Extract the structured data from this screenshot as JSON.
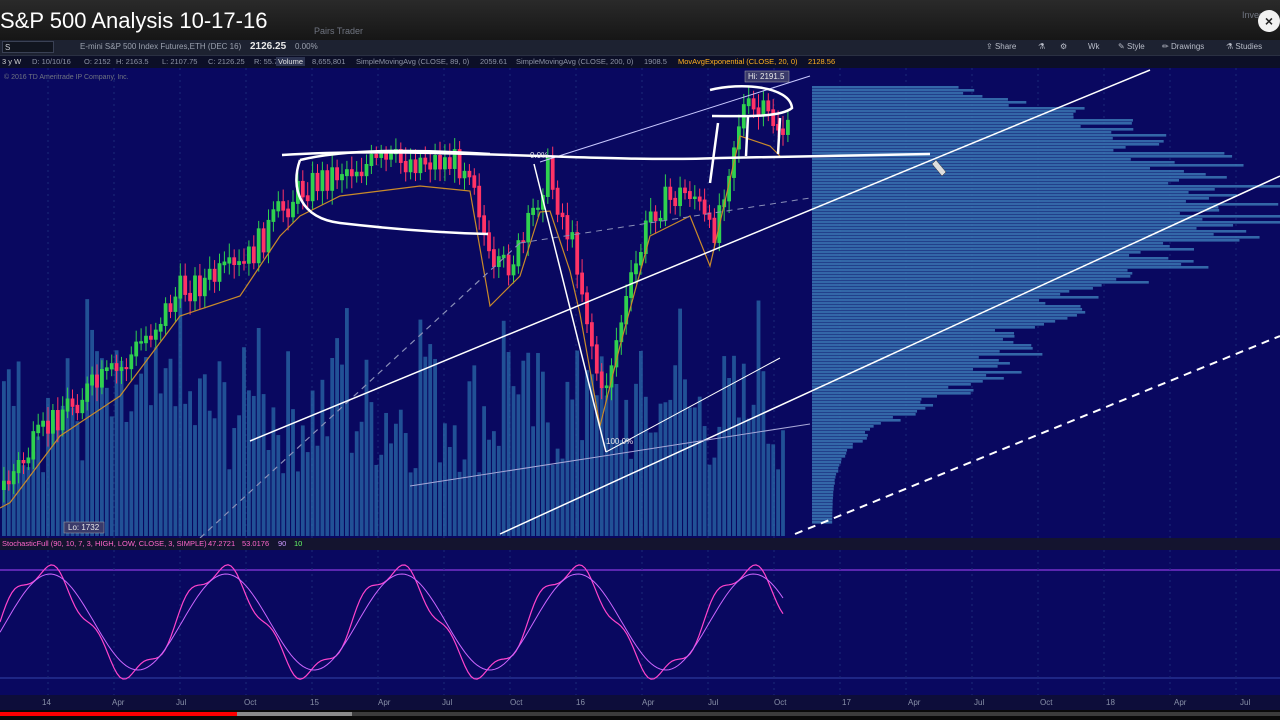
{
  "video": {
    "title": "S&P 500 Analysis 10-17-16",
    "top_right_text": "Inves",
    "progress_fraction": 0.185,
    "buffered_fraction": 0.275
  },
  "tabs_ghost": [
    "Pairs Trader"
  ],
  "toolbar": {
    "symbol": "S",
    "instrument": "E-mini S&P 500 Index Futures,ETH (DEC 16)",
    "last_price": "2126.25",
    "change": "0.00%",
    "buttons": [
      "Share",
      "Wk",
      "Style",
      "Drawings",
      "Studies"
    ]
  },
  "infobar": {
    "period": "3 y W",
    "date": "D: 10/10/16",
    "open": "O: 2152",
    "high": "H: 2163.5",
    "low": "L: 2107.75",
    "close": "C: 2126.25",
    "range": "R: 55.75",
    "volume_label": "Volume",
    "volume_value": "8,655,801",
    "sma89_label": "SimpleMovingAvg (CLOSE, 89, 0)",
    "sma89_value": "2059.61",
    "sma200_label": "SimpleMovingAvg (CLOSE, 200, 0)",
    "sma200_value": "1908.5",
    "ema_label": "MovAvgExponential (CLOSE, 20, 0)",
    "ema_value": "2128.56",
    "copyright": "© 2016 TD Ameritrade IP Company, Inc."
  },
  "chart_annotations": {
    "hi_label": "Hi: 2191.5",
    "lo_label": "Lo: 1732",
    "fib_top": "0.0%",
    "fib_bottom": "100.0%"
  },
  "oscillator": {
    "label": "StochasticFull (90, 10, 7, 3, HIGH, LOW, CLOSE, 3, SIMPLE)",
    "k_value": "47.2721",
    "d_value": "53.0176",
    "upper": "90",
    "lower": "10"
  },
  "x_axis_labels": [
    "14",
    "Apr",
    "Jul",
    "Oct",
    "15",
    "Apr",
    "Jul",
    "Oct",
    "16",
    "Apr",
    "Jul",
    "Oct",
    "17",
    "Apr",
    "Jul",
    "Oct",
    "18",
    "Apr",
    "Jul"
  ],
  "colors": {
    "background": "#090860",
    "candle_up": "#2fd14f",
    "candle_down": "#ff3366",
    "volume": "#2a6aa8",
    "profile": "#3b78b5",
    "drawing": "#ffffff",
    "ema_line": "#c98a2a",
    "stochastic": "#ff44cc",
    "accent_orange": "#ffb020"
  }
}
